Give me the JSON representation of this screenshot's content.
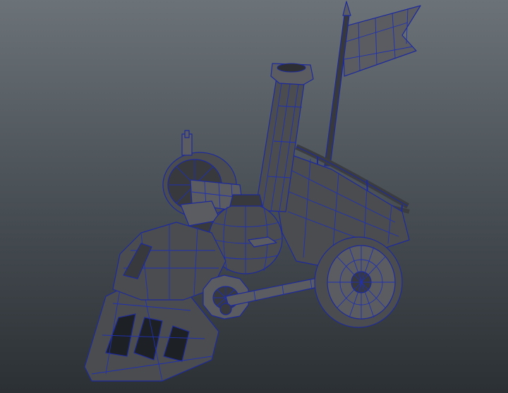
{
  "viewport": {
    "background_top": "#6b7278",
    "background_bottom": "#2b3034",
    "wireframe_color": "#1e2a9a",
    "shaded_color": "#4a4c50"
  }
}
